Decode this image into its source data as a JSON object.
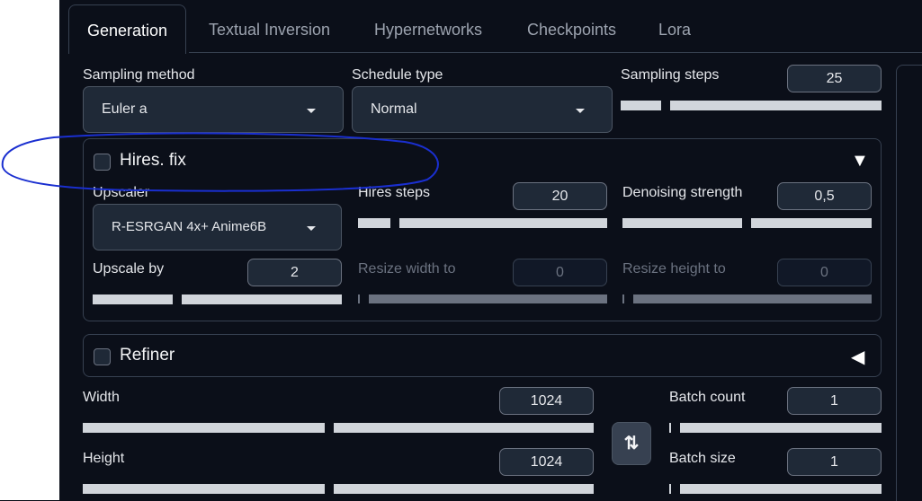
{
  "tabs": [
    "Generation",
    "Textual Inversion",
    "Hypernetworks",
    "Checkpoints",
    "Lora"
  ],
  "sampling": {
    "method_label": "Sampling method",
    "method_value": "Euler a",
    "schedule_label": "Schedule type",
    "schedule_value": "Normal",
    "steps_label": "Sampling steps",
    "steps_value": "25"
  },
  "hires": {
    "title": "Hires. fix",
    "upscaler_label": "Upscaler",
    "upscaler_value": "R-ESRGAN 4x+ Anime6B",
    "steps_label": "Hires steps",
    "steps_value": "20",
    "denoise_label": "Denoising strength",
    "denoise_value": "0,5",
    "upscale_by_label": "Upscale by",
    "upscale_by_value": "2",
    "resize_w_label": "Resize width to",
    "resize_w_value": "0",
    "resize_h_label": "Resize height to",
    "resize_h_value": "0"
  },
  "refiner": {
    "title": "Refiner"
  },
  "size": {
    "width_label": "Width",
    "width_value": "1024",
    "height_label": "Height",
    "height_value": "1024",
    "swap_icon": "⇅"
  },
  "batch": {
    "count_label": "Batch count",
    "count_value": "1",
    "size_label": "Batch size",
    "size_value": "1"
  },
  "icons": {
    "hires_arrow": "▼",
    "refiner_arrow": "◀"
  },
  "colors": {
    "annotation": "#1a2fd0"
  }
}
